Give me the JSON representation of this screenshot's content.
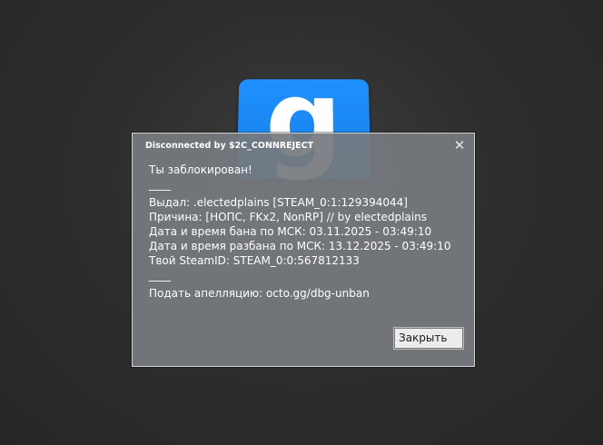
{
  "logo": {
    "letter": "g",
    "icon": "gmod-logo-icon",
    "color": "#1e90ff"
  },
  "dialog": {
    "title": "Disconnected by $2C_CONNREJECT",
    "close_icon": "✕",
    "lines": {
      "blocked": "Ты заблокирован!",
      "sep1": "____",
      "issued_by": "Выдал: .electedplains [STEAM_0:1:129394044]",
      "reason": "Причина: [НОПС, FKx2, NonRP] // by electedplains",
      "ban_date": "Дата и время бана по МСК: 03.11.2025 - 03:49:10",
      "unban_date": "Дата и время разбана по МСК: 13.12.2025 - 03:49:10",
      "steam_id": "Твой SteamID: STEAM_0:0:567812133",
      "sep2": "____",
      "appeal": "Подать апелляцию: octo.gg/dbg-unban"
    },
    "close_button_label": "Закрыть"
  }
}
